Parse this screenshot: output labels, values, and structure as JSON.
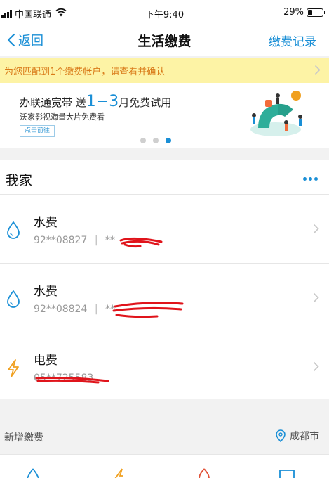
{
  "status_bar": {
    "carrier": "中国联通",
    "time": "下午9:40",
    "battery": "29%",
    "battery_level": 0.29
  },
  "nav": {
    "back_label": "返回",
    "title": "生活缴费",
    "right_label": "缴费记录"
  },
  "notice": {
    "text": "为您匹配到1个缴费帐户，请查看并确认"
  },
  "banner": {
    "line1_prefix": "办联通宽带  送",
    "line1_highlight": "1−3",
    "line1_suffix": "月免费试用",
    "line2": "沃家影视海量大片免费看",
    "button": "点击前往",
    "slide_count": 3,
    "active_slide": 3
  },
  "group": {
    "title": "我家",
    "accounts": [
      {
        "type": "水费",
        "number": "92**08827",
        "separator": "|",
        "masked": "**",
        "icon": "water-drop-icon"
      },
      {
        "type": "水费",
        "number": "92**08824",
        "separator": "|",
        "masked": "**",
        "icon": "water-drop-icon"
      },
      {
        "type": "电费",
        "number": "05**725583",
        "icon": "lightning-icon"
      }
    ]
  },
  "add_section": {
    "label": "新增缴费",
    "city": "成都市"
  },
  "colors": {
    "accent": "#1a8fd6",
    "notice_bg": "#fdf3a5",
    "notice_text": "#d97a18",
    "electric": "#f0a020",
    "redaction": "#e0141b"
  }
}
